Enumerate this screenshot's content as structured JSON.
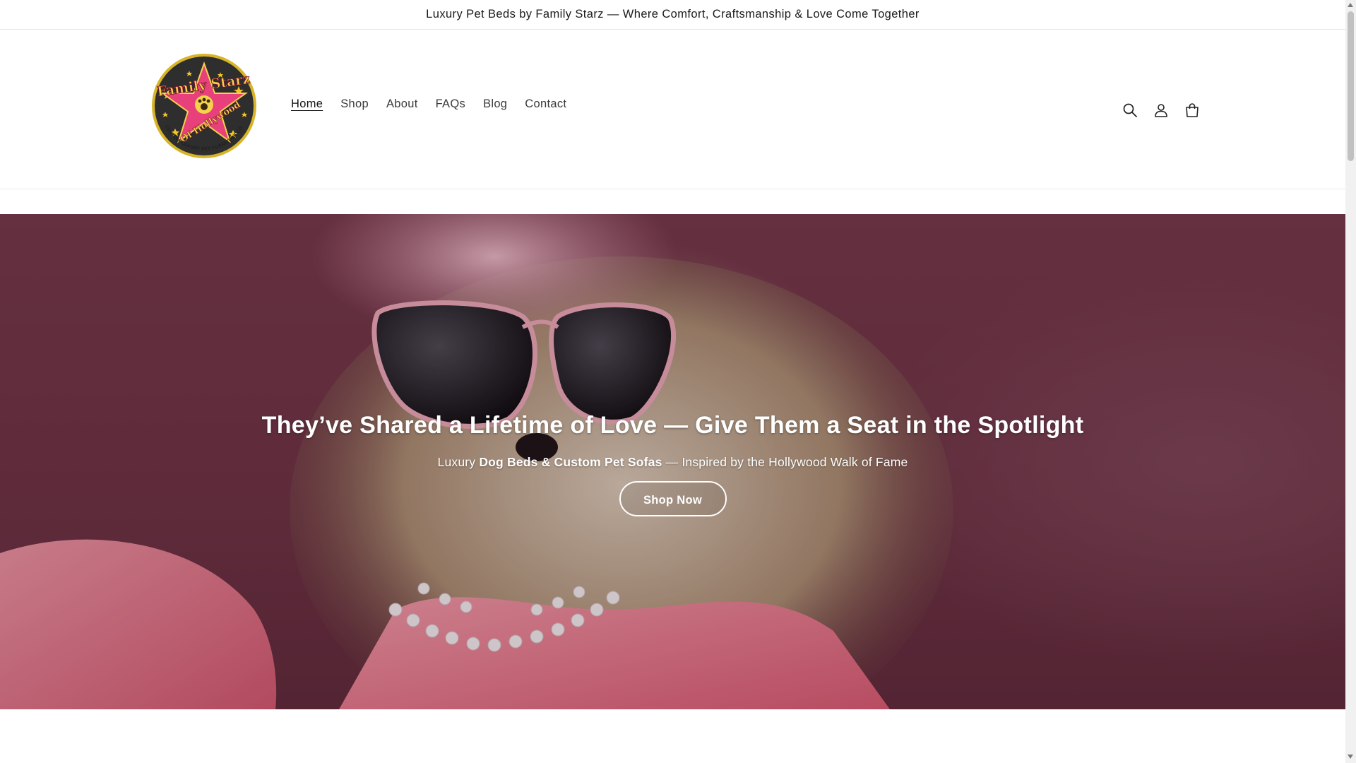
{
  "announcement": {
    "text": "Luxury Pet Beds by Family Starz — Where Comfort, Craftsmanship & Love Come Together"
  },
  "logo": {
    "line1": "Family Starz",
    "line2": "Of Hollywood",
    "ring_text": "CUSTOM LUXURY PET FURNITURE CO."
  },
  "nav": {
    "items": [
      {
        "label": "Home",
        "active": true
      },
      {
        "label": "Shop"
      },
      {
        "label": "About"
      },
      {
        "label": "FAQs"
      },
      {
        "label": "Blog"
      },
      {
        "label": "Contact"
      }
    ]
  },
  "header_icons": {
    "search": "search-icon",
    "account": "account-icon",
    "cart": "cart-icon"
  },
  "hero": {
    "title": "They’ve Shared a Lifetime of Love — Give Them a Seat in the Spotlight",
    "subtitle_pre": "Luxury ",
    "subtitle_bold": "Dog Beds & Custom Pet Sofas",
    "subtitle_post": " — Inspired by the Hollywood Walk of Fame",
    "cta_label": "Shop Now"
  },
  "colors": {
    "hero_bg": "#6e3546",
    "accent_pink": "#e8407a",
    "text": "#121212"
  }
}
